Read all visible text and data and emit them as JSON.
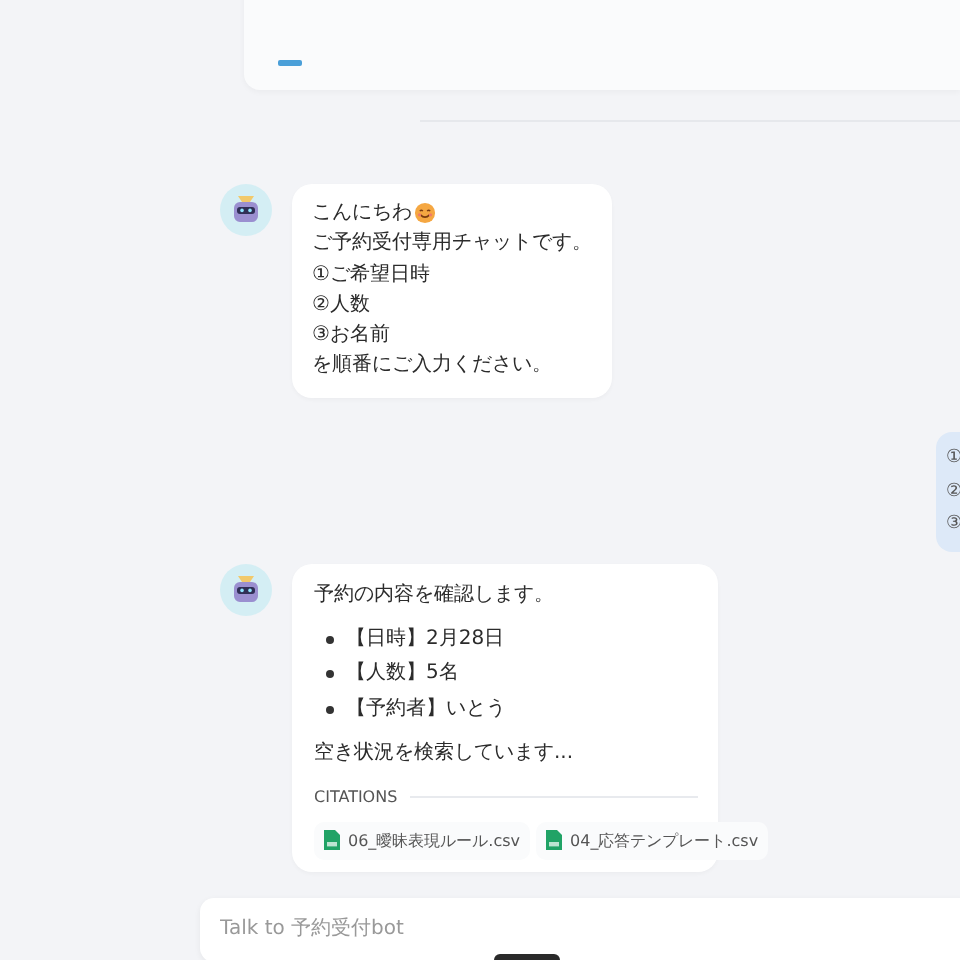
{
  "messages": [
    {
      "kind": "bot_lines",
      "lines": [
        "こんにちわ",
        "ご予約受付専用チャットです。",
        "①ご希望日時",
        "②人数",
        "③お名前",
        "を順番にご入力ください。"
      ],
      "emoji_after_first": true
    },
    {
      "kind": "user_lines",
      "lines": [
        "①",
        "②",
        "③"
      ]
    },
    {
      "kind": "bot_summary",
      "intro": "予約の内容を確認します。",
      "bullets": [
        "【日時】2月28日",
        "【人数】5名",
        "【予約者】いとう"
      ],
      "status": "空き状況を検索しています...",
      "citations_label": "CITATIONS",
      "citations": [
        "06_曖昧表現ルール.csv",
        "04_応答テンプレート.csv"
      ]
    }
  ],
  "input": {
    "placeholder": "Talk to 予約受付bot"
  }
}
